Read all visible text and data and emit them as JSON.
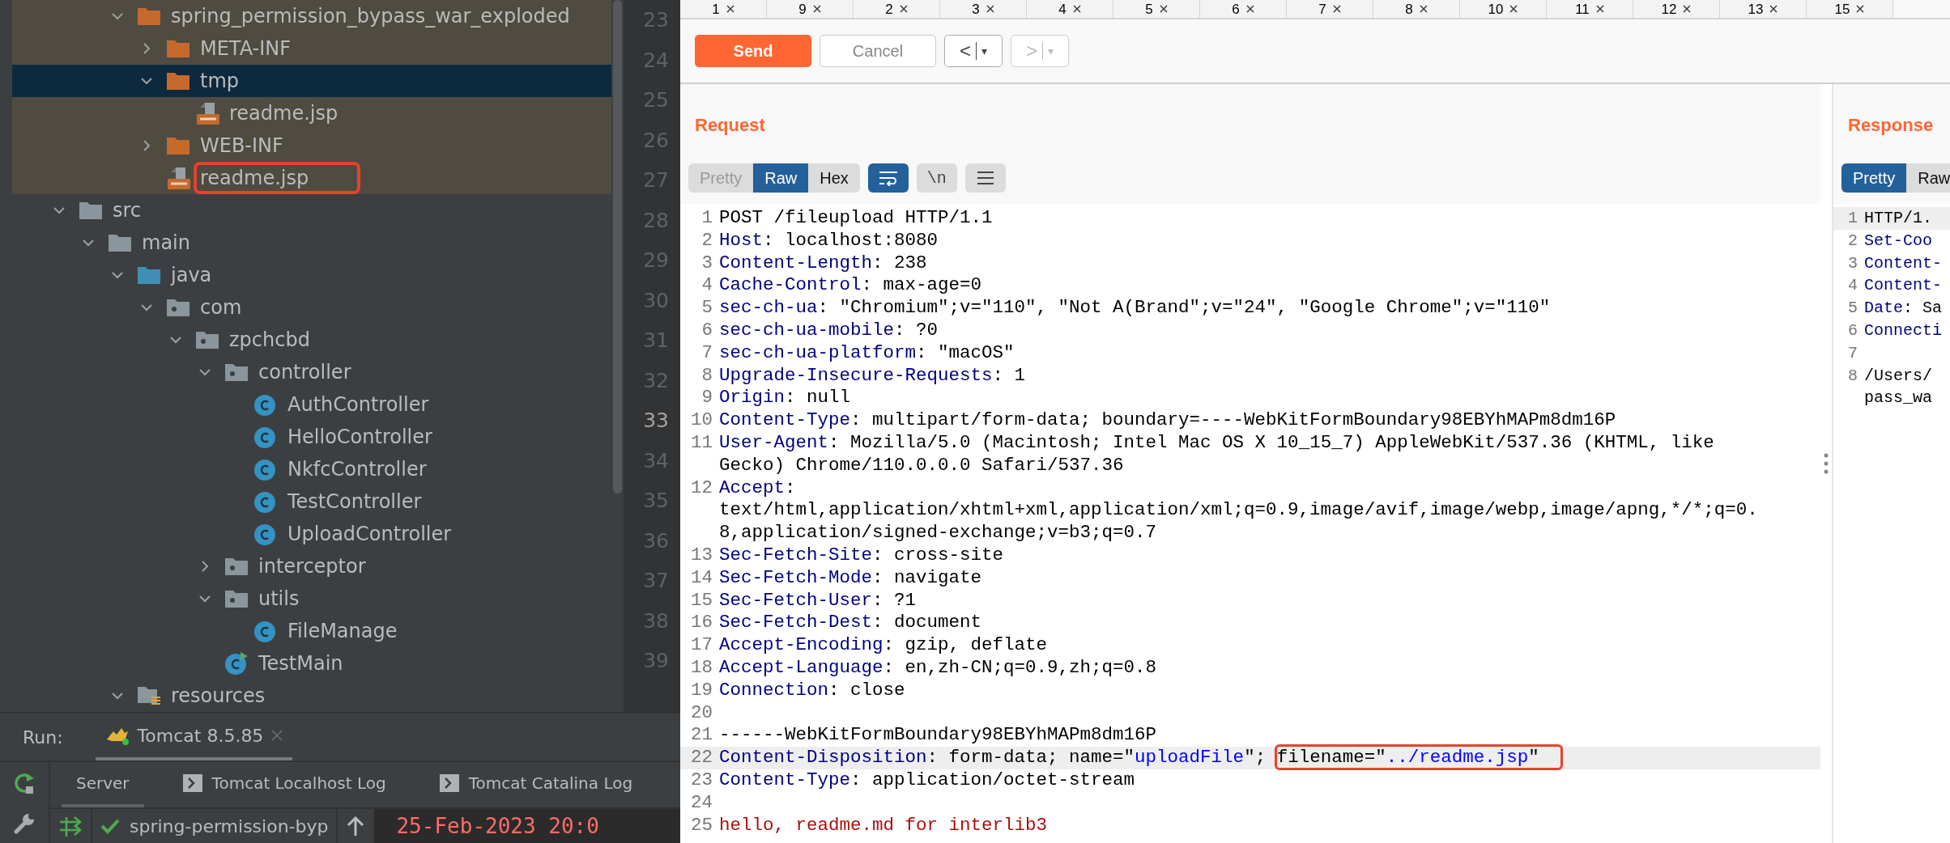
{
  "ide": {
    "tree": {
      "upper": {
        "excluded": true,
        "items": [
          {
            "label": "spring_permission_bypass_war_exploded",
            "kind": "folder-orange",
            "expanded": true,
            "selected": false,
            "outlined": false,
            "children": [
              {
                "label": "META-INF",
                "kind": "folder-orange",
                "expanded": false,
                "selected": false,
                "outlined": false
              },
              {
                "label": "tmp",
                "kind": "folder-orange",
                "expanded": true,
                "selected": true,
                "outlined": false,
                "children": [
                  {
                    "label": "readme.jsp",
                    "kind": "jsp",
                    "selected": false,
                    "outlined": false
                  }
                ]
              },
              {
                "label": "WEB-INF",
                "kind": "folder-orange",
                "expanded": false,
                "selected": false,
                "outlined": false
              },
              {
                "label": "readme.jsp",
                "kind": "jsp",
                "selected": false,
                "outlined": true
              }
            ]
          }
        ]
      },
      "lower": {
        "excluded": false,
        "items": [
          {
            "label": "src",
            "kind": "folder-gray",
            "expanded": true,
            "selected": false,
            "outlined": false,
            "children": [
              {
                "label": "main",
                "kind": "folder-gray",
                "expanded": true,
                "selected": false,
                "outlined": false,
                "children": [
                  {
                    "label": "java",
                    "kind": "folder-blue",
                    "expanded": true,
                    "selected": false,
                    "outlined": false,
                    "children": [
                      {
                        "label": "com",
                        "kind": "package",
                        "expanded": true,
                        "selected": false,
                        "outlined": false,
                        "children": [
                          {
                            "label": "zpchcbd",
                            "kind": "package",
                            "expanded": true,
                            "selected": false,
                            "outlined": false,
                            "children": [
                              {
                                "label": "controller",
                                "kind": "package",
                                "expanded": true,
                                "selected": false,
                                "outlined": false,
                                "children": [
                                  {
                                    "label": "AuthController",
                                    "kind": "class",
                                    "selected": false,
                                    "outlined": false
                                  },
                                  {
                                    "label": "HelloController",
                                    "kind": "class",
                                    "selected": false,
                                    "outlined": false
                                  },
                                  {
                                    "label": "NkfcController",
                                    "kind": "class",
                                    "selected": false,
                                    "outlined": false
                                  },
                                  {
                                    "label": "TestController",
                                    "kind": "class",
                                    "selected": false,
                                    "outlined": false
                                  },
                                  {
                                    "label": "UploadController",
                                    "kind": "class",
                                    "selected": false,
                                    "outlined": false
                                  }
                                ]
                              },
                              {
                                "label": "interceptor",
                                "kind": "package",
                                "expanded": false,
                                "selected": false,
                                "outlined": false
                              },
                              {
                                "label": "utils",
                                "kind": "package",
                                "expanded": true,
                                "selected": false,
                                "outlined": false,
                                "children": [
                                  {
                                    "label": "FileManage",
                                    "kind": "class",
                                    "selected": false,
                                    "outlined": false
                                  }
                                ]
                              },
                              {
                                "label": "TestMain",
                                "kind": "main-class",
                                "selected": false,
                                "outlined": false
                              }
                            ]
                          }
                        ]
                      }
                    ]
                  },
                  {
                    "label": "resources",
                    "kind": "resources",
                    "expanded": true,
                    "selected": false,
                    "outlined": false
                  }
                ]
              }
            ]
          }
        ]
      }
    },
    "gutter": [
      {
        "n": "23",
        "current": false
      },
      {
        "n": "24",
        "current": false
      },
      {
        "n": "25",
        "current": false
      },
      {
        "n": "26",
        "current": false
      },
      {
        "n": "27",
        "current": false
      },
      {
        "n": "28",
        "current": false
      },
      {
        "n": "29",
        "current": false
      },
      {
        "n": "30",
        "current": false
      },
      {
        "n": "31",
        "current": false
      },
      {
        "n": "32",
        "current": false
      },
      {
        "n": "33",
        "current": true
      },
      {
        "n": "34",
        "current": false
      },
      {
        "n": "35",
        "current": false
      },
      {
        "n": "36",
        "current": false
      },
      {
        "n": "37",
        "current": false
      },
      {
        "n": "38",
        "current": false
      },
      {
        "n": "39",
        "current": false
      }
    ],
    "run": {
      "label": "Run:",
      "tabs": [
        {
          "label": "Tomcat 8.5.85",
          "selected": true
        }
      ],
      "sub_tabs": [
        {
          "label": "Server",
          "kind": "plain",
          "selected": true
        },
        {
          "label": "Tomcat Localhost Log",
          "kind": "log",
          "selected": false
        },
        {
          "label": "Tomcat Catalina Log",
          "kind": "log",
          "selected": false
        }
      ],
      "deployment": "spring-permission-byp",
      "console": "25-Feb-2023 20:0"
    }
  },
  "burp": {
    "tabs": [
      {
        "label": "1"
      },
      {
        "label": "9"
      },
      {
        "label": "2"
      },
      {
        "label": "3"
      },
      {
        "label": "4"
      },
      {
        "label": "5"
      },
      {
        "label": "6"
      },
      {
        "label": "7"
      },
      {
        "label": "8"
      },
      {
        "label": "10"
      },
      {
        "label": "11"
      },
      {
        "label": "12"
      },
      {
        "label": "13"
      },
      {
        "label": "15"
      }
    ],
    "send": {
      "label": "Send",
      "disabled": false
    },
    "cancel": {
      "label": "Cancel",
      "disabled": true
    },
    "nav": [
      {
        "label": "<",
        "menu": "▾",
        "disabled": false
      },
      {
        "label": ">",
        "menu": "▾",
        "disabled": true
      }
    ],
    "request": {
      "title": "Request",
      "modes": [
        {
          "label": "Pretty",
          "selected": false,
          "disabled": true
        },
        {
          "label": "Raw",
          "selected": true,
          "disabled": false
        },
        {
          "label": "Hex",
          "selected": false,
          "disabled": false
        }
      ],
      "toggles": [
        {
          "kind": "wrap",
          "on": true
        },
        {
          "kind": "text",
          "label": "\\n",
          "on": false
        },
        {
          "kind": "menu",
          "on": false
        }
      ],
      "lines": [
        {
          "n": "1",
          "current": false,
          "rows": [
            [
              {
                "t": "POST /fileupload HTTP/1.1",
                "kind": "plain"
              }
            ]
          ]
        },
        {
          "n": "2",
          "current": false,
          "rows": [
            [
              {
                "t": "Host",
                "kind": "name"
              },
              {
                "t": ": localhost:8080",
                "kind": "plain"
              }
            ]
          ]
        },
        {
          "n": "3",
          "current": false,
          "rows": [
            [
              {
                "t": "Content-Length",
                "kind": "name"
              },
              {
                "t": ": 238",
                "kind": "plain"
              }
            ]
          ]
        },
        {
          "n": "4",
          "current": false,
          "rows": [
            [
              {
                "t": "Cache-Control",
                "kind": "name"
              },
              {
                "t": ": max-age=0",
                "kind": "plain"
              }
            ]
          ]
        },
        {
          "n": "5",
          "current": false,
          "rows": [
            [
              {
                "t": "sec-ch-ua",
                "kind": "name"
              },
              {
                "t": ": \"Chromium\";v=\"110\", \"Not A(Brand\";v=\"24\", \"Google Chrome\";v=\"110\"",
                "kind": "plain"
              }
            ]
          ]
        },
        {
          "n": "6",
          "current": false,
          "rows": [
            [
              {
                "t": "sec-ch-ua-mobile",
                "kind": "name"
              },
              {
                "t": ": ?0",
                "kind": "plain"
              }
            ]
          ]
        },
        {
          "n": "7",
          "current": false,
          "rows": [
            [
              {
                "t": "sec-ch-ua-platform",
                "kind": "name"
              },
              {
                "t": ": \"macOS\"",
                "kind": "plain"
              }
            ]
          ]
        },
        {
          "n": "8",
          "current": false,
          "rows": [
            [
              {
                "t": "Upgrade-Insecure-Requests",
                "kind": "name"
              },
              {
                "t": ": 1",
                "kind": "plain"
              }
            ]
          ]
        },
        {
          "n": "9",
          "current": false,
          "rows": [
            [
              {
                "t": "Origin",
                "kind": "name"
              },
              {
                "t": ": null",
                "kind": "plain"
              }
            ]
          ]
        },
        {
          "n": "10",
          "current": false,
          "rows": [
            [
              {
                "t": "Content-Type",
                "kind": "name"
              },
              {
                "t": ": multipart/form-data; boundary=----WebKitFormBoundary98EBYhMAPm8dm16P",
                "kind": "plain"
              }
            ]
          ]
        },
        {
          "n": "11",
          "current": false,
          "rows": [
            [
              {
                "t": "User-Agent",
                "kind": "name"
              },
              {
                "t": ": Mozilla/5.0 (Macintosh; Intel Mac OS X 10_15_7) AppleWebKit/537.36 (KHTML, like",
                "kind": "plain"
              }
            ],
            [
              {
                "t": "Gecko) Chrome/110.0.0.0 Safari/537.36",
                "kind": "plain"
              }
            ]
          ]
        },
        {
          "n": "12",
          "current": false,
          "rows": [
            [
              {
                "t": "Accept",
                "kind": "name"
              },
              {
                "t": ":",
                "kind": "plain"
              }
            ],
            [
              {
                "t": "text/html,application/xhtml+xml,application/xml;q=0.9,image/avif,image/webp,image/apng,*/*;q=0.",
                "kind": "plain"
              }
            ],
            [
              {
                "t": "8,application/signed-exchange;v=b3;q=0.7",
                "kind": "plain"
              }
            ]
          ]
        },
        {
          "n": "13",
          "current": false,
          "rows": [
            [
              {
                "t": "Sec-Fetch-Site",
                "kind": "name"
              },
              {
                "t": ": cross-site",
                "kind": "plain"
              }
            ]
          ]
        },
        {
          "n": "14",
          "current": false,
          "rows": [
            [
              {
                "t": "Sec-Fetch-Mode",
                "kind": "name"
              },
              {
                "t": ": navigate",
                "kind": "plain"
              }
            ]
          ]
        },
        {
          "n": "15",
          "current": false,
          "rows": [
            [
              {
                "t": "Sec-Fetch-User",
                "kind": "name"
              },
              {
                "t": ": ?1",
                "kind": "plain"
              }
            ]
          ]
        },
        {
          "n": "16",
          "current": false,
          "rows": [
            [
              {
                "t": "Sec-Fetch-Dest",
                "kind": "name"
              },
              {
                "t": ": document",
                "kind": "plain"
              }
            ]
          ]
        },
        {
          "n": "17",
          "current": false,
          "rows": [
            [
              {
                "t": "Accept-Encoding",
                "kind": "name"
              },
              {
                "t": ": gzip, deflate",
                "kind": "plain"
              }
            ]
          ]
        },
        {
          "n": "18",
          "current": false,
          "rows": [
            [
              {
                "t": "Accept-Language",
                "kind": "name"
              },
              {
                "t": ": en,zh-CN;q=0.9,zh;q=0.8",
                "kind": "plain"
              }
            ]
          ]
        },
        {
          "n": "19",
          "current": false,
          "rows": [
            [
              {
                "t": "Connection",
                "kind": "name"
              },
              {
                "t": ": close",
                "kind": "plain"
              }
            ]
          ]
        },
        {
          "n": "20",
          "current": false,
          "rows": [
            []
          ]
        },
        {
          "n": "21",
          "current": false,
          "rows": [
            [
              {
                "t": "------WebKitFormBoundary98EBYhMAPm8dm16P",
                "kind": "plain"
              }
            ]
          ]
        },
        {
          "n": "22",
          "current": true,
          "rows": [
            [
              {
                "t": "Content-Disposition",
                "kind": "name"
              },
              {
                "t": ": form-data; name=\"",
                "kind": "plain"
              },
              {
                "t": "uploadFile",
                "kind": "string"
              },
              {
                "t": "\"; ",
                "kind": "plain"
              },
              {
                "kind": "boxed",
                "segs": [
                  {
                    "t": "filename=\"",
                    "kind": "plain"
                  },
                  {
                    "t": "../readme.jsp",
                    "kind": "string"
                  },
                  {
                    "t": "\"",
                    "kind": "plain"
                  }
                ]
              }
            ]
          ]
        },
        {
          "n": "23",
          "current": false,
          "rows": [
            [
              {
                "t": "Content-Type",
                "kind": "name"
              },
              {
                "t": ": application/octet-stream",
                "kind": "plain"
              }
            ]
          ]
        },
        {
          "n": "24",
          "current": false,
          "rows": [
            []
          ]
        },
        {
          "n": "25",
          "current": false,
          "rows": [
            [
              {
                "t": "hello, readme.md for interlib3",
                "kind": "body"
              }
            ]
          ]
        }
      ]
    },
    "response": {
      "title": "Response",
      "modes": [
        {
          "label": "Pretty",
          "selected": true,
          "disabled": false
        },
        {
          "label": "Raw",
          "selected": false,
          "disabled": false
        }
      ],
      "lines": [
        {
          "n": "1",
          "current": true,
          "rows": [
            [
              {
                "t": "HTTP/1.",
                "kind": "plain"
              }
            ]
          ]
        },
        {
          "n": "2",
          "current": false,
          "rows": [
            [
              {
                "t": "Set-Coo",
                "kind": "name"
              }
            ]
          ]
        },
        {
          "n": "3",
          "current": false,
          "rows": [
            [
              {
                "t": "Content-",
                "kind": "name"
              }
            ]
          ]
        },
        {
          "n": "4",
          "current": false,
          "rows": [
            [
              {
                "t": "Content-",
                "kind": "name"
              }
            ]
          ]
        },
        {
          "n": "5",
          "current": false,
          "rows": [
            [
              {
                "t": "Date",
                "kind": "name"
              },
              {
                "t": ": Sa",
                "kind": "plain"
              }
            ]
          ]
        },
        {
          "n": "6",
          "current": false,
          "rows": [
            [
              {
                "t": "Connecti",
                "kind": "name"
              }
            ]
          ]
        },
        {
          "n": "7",
          "current": false,
          "rows": [
            []
          ]
        },
        {
          "n": "8",
          "current": false,
          "rows": [
            [
              {
                "t": "/Users/",
                "kind": "plain"
              }
            ],
            [
              {
                "t": "pass_wa",
                "kind": "plain"
              }
            ]
          ]
        }
      ]
    }
  }
}
